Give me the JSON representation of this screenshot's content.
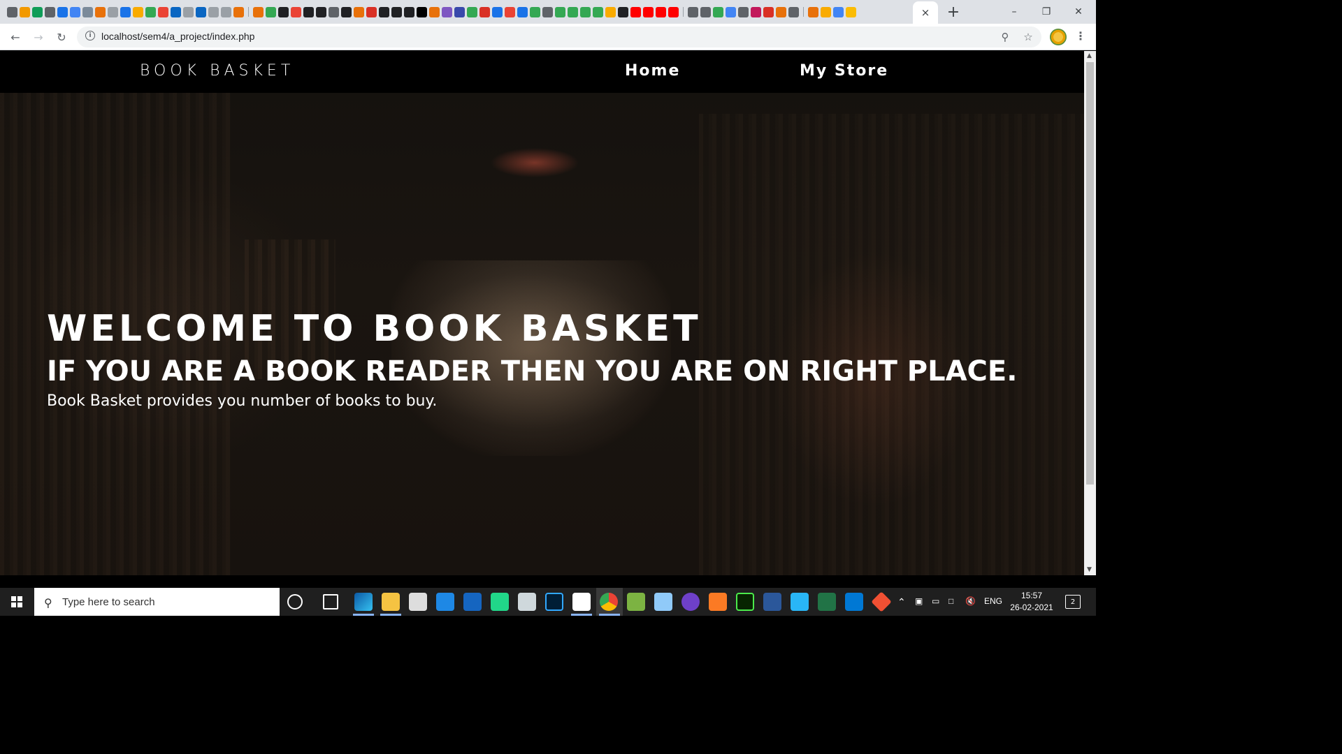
{
  "browser": {
    "tab_close": "×",
    "new_tab": "+",
    "url": "localhost/sem4/a_project/index.php",
    "window_controls": {
      "minimize": "–",
      "maximize": "❐",
      "close": "✕"
    }
  },
  "site": {
    "brand": "BOOK BASKET",
    "nav": [
      {
        "label": "Home"
      },
      {
        "label": "My Store"
      }
    ]
  },
  "hero": {
    "title": "WELCOME TO BOOK BASKET",
    "subtitle": "IF YOU ARE A BOOK READER THEN YOU ARE ON RIGHT PLACE.",
    "text": "Book Basket provides you number of books to buy."
  },
  "taskbar": {
    "search_placeholder": "Type here to search",
    "language": "ENG",
    "time": "15:57",
    "date": "26-02-2021",
    "notifications": "2",
    "apps": [
      "edge-icon",
      "file-explorer-icon",
      "store-icon",
      "mail-icon",
      "outlook-icon",
      "pycharm-icon",
      "paint-icon",
      "photoshop-icon",
      "snip-icon",
      "chrome-icon",
      "notepadplus-icon",
      "dictionary-icon",
      "github-icon",
      "xampp-icon",
      "dreamweaver-icon",
      "word-icon",
      "photos-icon",
      "excel-icon",
      "vscode-icon",
      "git-icon"
    ]
  }
}
